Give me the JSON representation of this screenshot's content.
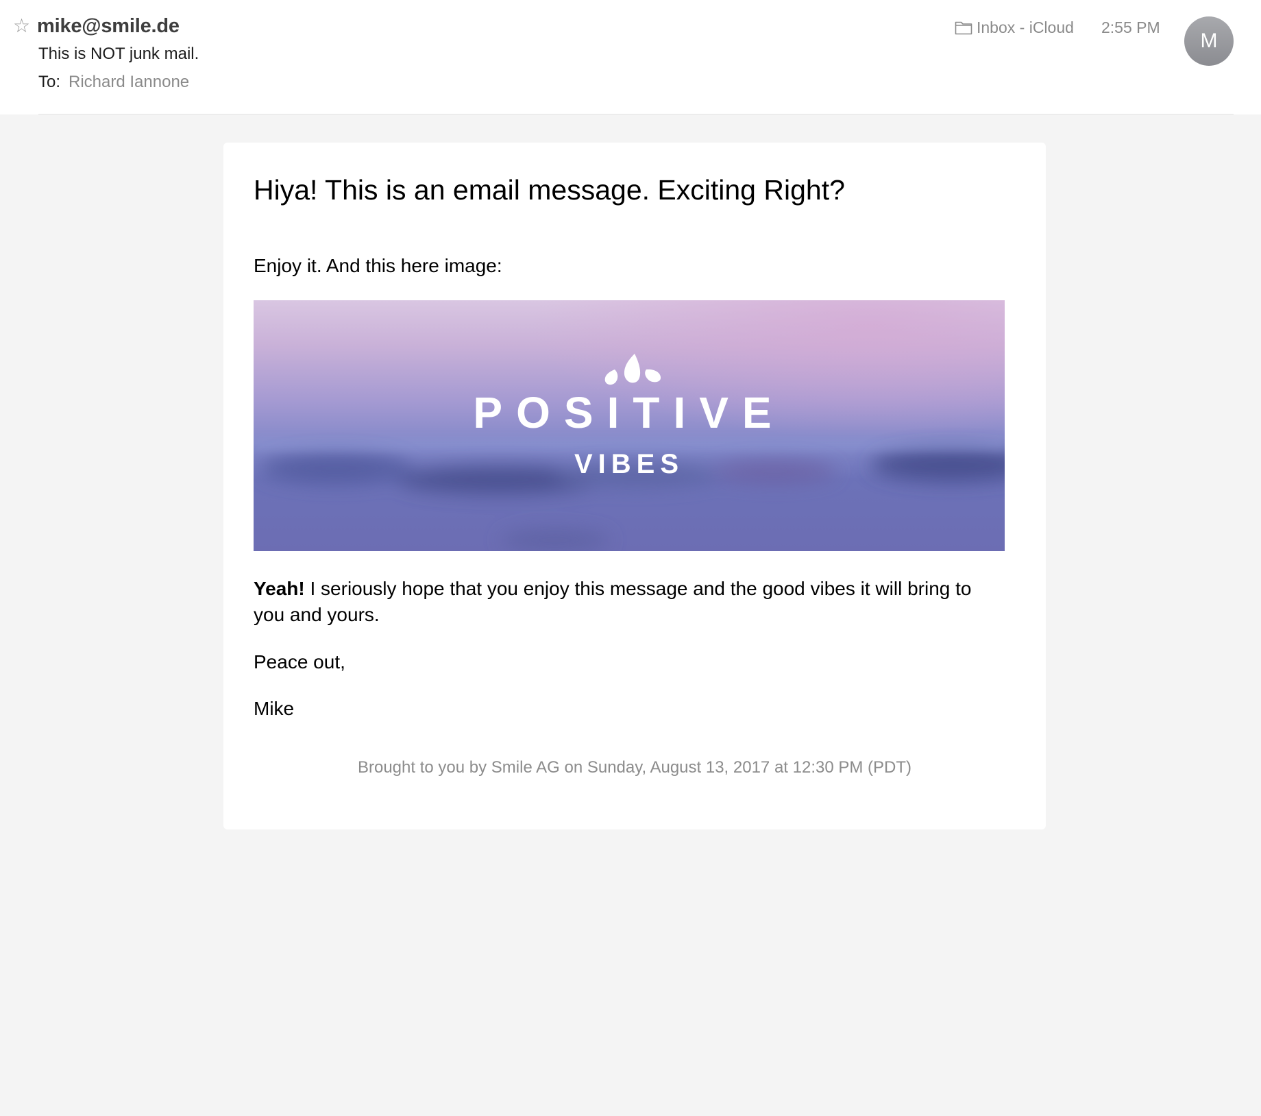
{
  "header": {
    "star_icon": "star-outline-icon",
    "star_glyph": "☆",
    "sender": "mike@smile.de",
    "subject": "This is NOT junk mail.",
    "to_label": "To:",
    "to_value": "Richard Iannone",
    "mailbox_icon": "folder-icon",
    "mailbox": "Inbox - iCloud",
    "time": "2:55 PM",
    "avatar_initial": "M"
  },
  "message": {
    "title": "Hiya! This is an email message. Exciting Right?",
    "intro": "Enjoy it. And this here image:",
    "image": {
      "brand_word": "POSITIVE",
      "brand_sub": "VIBES",
      "logo_icon": "petals-logo-icon"
    },
    "para_bold": "Yeah!",
    "para_rest": " I seriously hope that you enjoy this message and the good vibes it will bring to you and yours.",
    "closing": "Peace out,",
    "signature": "Mike",
    "footer": "Brought to you by Smile AG on Sunday, August 13, 2017 at 12:30 PM (PDT)"
  },
  "colors": {
    "background": "#f4f4f4",
    "card": "#ffffff",
    "muted_text": "#8a8a8a",
    "avatar": "#9a9ba0"
  }
}
